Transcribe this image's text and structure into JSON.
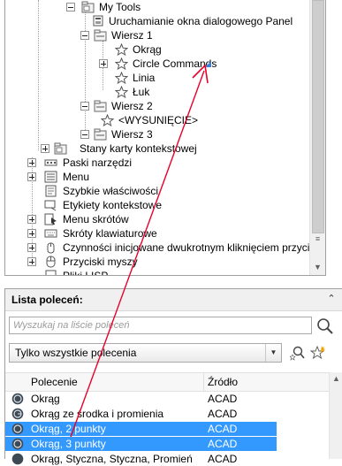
{
  "tree": {
    "items": [
      {
        "label": "My Tools",
        "icon": "folder-icon"
      },
      {
        "label": "Uruchamianie okna dialogowego Panel",
        "icon": "panel-icon"
      },
      {
        "label": "Wiersz 1",
        "icon": "row-folder-icon"
      },
      {
        "label": "Okrąg",
        "icon": "star-icon"
      },
      {
        "label": "Circle Commands",
        "icon": "star-icon"
      },
      {
        "label": "Linia",
        "icon": "star-icon"
      },
      {
        "label": "Łuk",
        "icon": "star-icon"
      },
      {
        "label": "Wiersz 2",
        "icon": "row-folder-icon"
      },
      {
        "label": "<WYSUNIĘCIE>",
        "icon": "star-icon"
      },
      {
        "label": "Wiersz 3",
        "icon": "row-folder-icon"
      },
      {
        "label": "Stany karty kontekstowej",
        "icon": "folder-icon"
      },
      {
        "label": "Paski narzędzi",
        "icon": "toolbar-icon"
      },
      {
        "label": "Menu",
        "icon": "menu-icon"
      },
      {
        "label": "Szybkie właściwości",
        "icon": "properties-icon"
      },
      {
        "label": "Etykiety kontekstowe",
        "icon": "tooltip-icon"
      },
      {
        "label": "Menu skrótów",
        "icon": "shortcut-menu-icon"
      },
      {
        "label": "Skróty klawiaturowe",
        "icon": "keyboard-icon"
      },
      {
        "label": "Czynności inicjowane dwukrotnym kliknięciem przycisku myszy",
        "icon": "double-click-icon"
      },
      {
        "label": "Przyciski myszy",
        "icon": "mouse-icon"
      },
      {
        "label": "Pliki LISP",
        "icon": "lisp-icon"
      }
    ]
  },
  "command_list": {
    "title": "Lista poleceń:",
    "search_placeholder": "Wyszukaj na liście poleceń",
    "filter_value": "Tylko wszystkie polecenia",
    "columns": {
      "command": "Polecenie",
      "source": "Źródło"
    },
    "rows": [
      {
        "command": "Okrąg",
        "source": "ACAD",
        "selected": false
      },
      {
        "command": "Okrąg ze środka i promienia",
        "source": "ACAD",
        "selected": false
      },
      {
        "command": "Okrąg, 2 punkty",
        "source": "ACAD",
        "selected": true
      },
      {
        "command": "Okrąg, 3 punkty",
        "source": "ACAD",
        "selected": true
      },
      {
        "command": "Okrąg, Styczna, Styczna, Promień",
        "source": "ACAD",
        "selected": false
      }
    ]
  },
  "colors": {
    "selection": "#3399ff",
    "drag_arrow": "#e8002a"
  }
}
